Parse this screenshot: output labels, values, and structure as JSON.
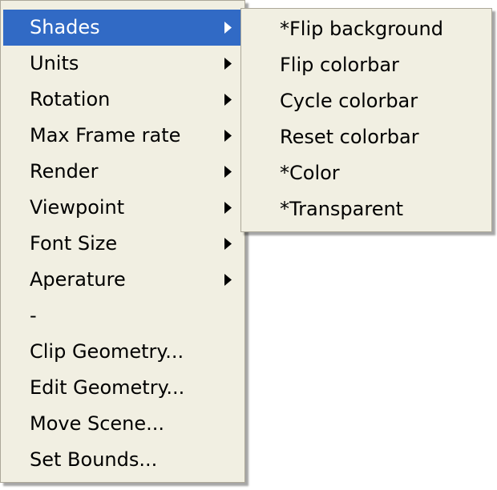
{
  "main_menu": {
    "items": [
      {
        "label": "Shades",
        "has_submenu": true,
        "highlighted": true
      },
      {
        "label": "Units",
        "has_submenu": true
      },
      {
        "label": "Rotation",
        "has_submenu": true
      },
      {
        "label": "Max Frame rate",
        "has_submenu": true
      },
      {
        "label": "Render",
        "has_submenu": true
      },
      {
        "label": "Viewpoint",
        "has_submenu": true
      },
      {
        "label": "Font Size",
        "has_submenu": true
      },
      {
        "label": "Aperature",
        "has_submenu": true
      },
      {
        "label": "-",
        "has_submenu": false
      },
      {
        "label": "Clip Geometry...",
        "has_submenu": false
      },
      {
        "label": "Edit Geometry...",
        "has_submenu": false
      },
      {
        "label": "Move Scene...",
        "has_submenu": false
      },
      {
        "label": "Set Bounds...",
        "has_submenu": false
      }
    ]
  },
  "shades_submenu": {
    "items": [
      {
        "label": "*Flip background"
      },
      {
        "label": "Flip colorbar"
      },
      {
        "label": "Cycle colorbar"
      },
      {
        "label": "Reset colorbar"
      },
      {
        "label": "*Color"
      },
      {
        "label": "*Transparent"
      }
    ]
  },
  "colors": {
    "menu_background": "#f1efe2",
    "highlight": "#316ac5",
    "border": "#aca899"
  },
  "icons": {
    "submenu_arrow": "chevron-right-icon"
  }
}
